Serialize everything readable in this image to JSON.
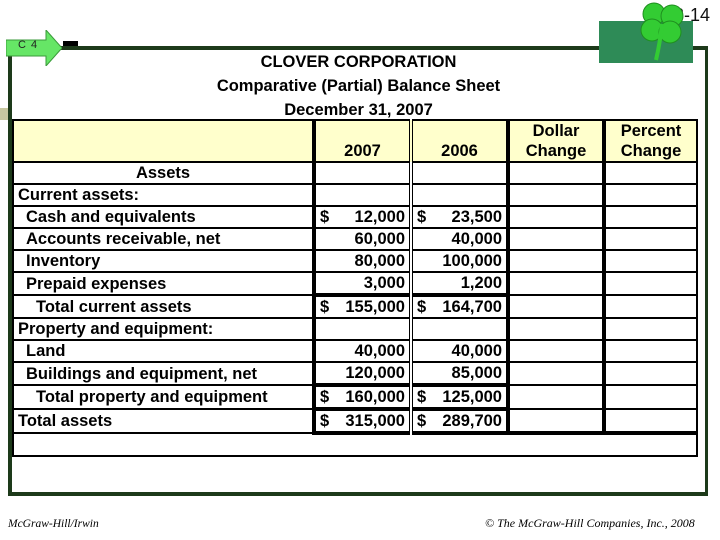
{
  "slide": {
    "number": "3-14",
    "chapter_tag": "C 4",
    "colors": {
      "frame": "#1d3a1a",
      "header_fill": "#ffffcc",
      "arrow_fill": "#66e666",
      "clover_box": "#2e8b57",
      "clover": "#33cc33"
    }
  },
  "header": {
    "company": "CLOVER CORPORATION",
    "statement": "Comparative (Partial) Balance Sheet",
    "date": "December 31, 2007"
  },
  "table": {
    "columns": [
      "",
      "2007",
      "2006",
      "Dollar Change",
      "Percent Change"
    ],
    "column_lines": {
      "dollar_change": [
        "Dollar",
        "Change"
      ],
      "percent_change": [
        "Percent",
        "Change"
      ]
    },
    "rows": [
      {
        "label": "Assets",
        "y2007": "",
        "y2006": "",
        "dollar_change": "",
        "percent_change": ""
      },
      {
        "label": "Current assets:",
        "y2007": "",
        "y2006": "",
        "dollar_change": "",
        "percent_change": ""
      },
      {
        "label": "Cash and equivalents",
        "y2007_cur": "$",
        "y2007": "12,000",
        "y2006_cur": "$",
        "y2006": "23,500",
        "dollar_change": "",
        "percent_change": ""
      },
      {
        "label": "Accounts receivable, net",
        "y2007": "60,000",
        "y2006": "40,000",
        "dollar_change": "",
        "percent_change": ""
      },
      {
        "label": "Inventory",
        "y2007": "80,000",
        "y2006": "100,000",
        "dollar_change": "",
        "percent_change": ""
      },
      {
        "label": "Prepaid expenses",
        "y2007": "3,000",
        "y2006": "1,200",
        "dollar_change": "",
        "percent_change": ""
      },
      {
        "label": "Total current assets",
        "y2007_cur": "$",
        "y2007": "155,000",
        "y2006_cur": "$",
        "y2006": "164,700",
        "dollar_change": "",
        "percent_change": ""
      },
      {
        "label": "Property and equipment:",
        "y2007": "",
        "y2006": "",
        "dollar_change": "",
        "percent_change": ""
      },
      {
        "label": "Land",
        "y2007": "40,000",
        "y2006": "40,000",
        "dollar_change": "",
        "percent_change": ""
      },
      {
        "label": "Buildings and equipment, net",
        "y2007": "120,000",
        "y2006": "85,000",
        "dollar_change": "",
        "percent_change": ""
      },
      {
        "label": "Total property and equipment",
        "y2007_cur": "$",
        "y2007": "160,000",
        "y2006_cur": "$",
        "y2006": "125,000",
        "dollar_change": "",
        "percent_change": ""
      },
      {
        "label": "Total assets",
        "y2007_cur": "$",
        "y2007": "315,000",
        "y2006_cur": "$",
        "y2006": "289,700",
        "dollar_change": "",
        "percent_change": ""
      }
    ]
  },
  "footer": {
    "publisher": "McGraw-Hill/Irwin",
    "copyright": "© The McGraw-Hill Companies, Inc., 2008"
  }
}
